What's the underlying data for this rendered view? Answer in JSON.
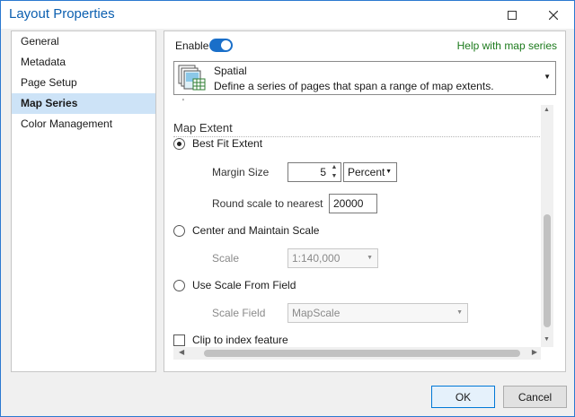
{
  "window": {
    "title": "Layout Properties"
  },
  "sidebar": {
    "items": [
      {
        "label": "General",
        "active": false
      },
      {
        "label": "Metadata",
        "active": false
      },
      {
        "label": "Page Setup",
        "active": false
      },
      {
        "label": "Map Series",
        "active": true
      },
      {
        "label": "Color Management",
        "active": false
      }
    ]
  },
  "header": {
    "enable_label": "Enable",
    "enable_on": true,
    "help_link": "Help with map series"
  },
  "series_type": {
    "title": "Spatial",
    "description": "Define a series of pages that span a range of map extents."
  },
  "map_extent": {
    "section_title": "Map Extent",
    "best_fit": {
      "label": "Best Fit Extent",
      "checked": true,
      "margin_size_label": "Margin Size",
      "margin_size_value": "5",
      "margin_unit": "Percent",
      "round_scale_label": "Round scale to nearest",
      "round_scale_value": "20000"
    },
    "center_maintain": {
      "label": "Center and Maintain Scale",
      "checked": false,
      "scale_label": "Scale",
      "scale_value": "1:140,000"
    },
    "scale_from_field": {
      "label": "Use Scale From Field",
      "checked": false,
      "scale_field_label": "Scale Field",
      "scale_field_value": "MapScale"
    },
    "clip": {
      "label": "Clip to index feature",
      "checked": false
    }
  },
  "buttons": {
    "ok": "OK",
    "cancel": "Cancel"
  },
  "colors": {
    "accent": "#1a6fc9",
    "title": "#0b5fb0",
    "help_link": "#1c7a1c",
    "selected_item": "#cde3f7"
  }
}
